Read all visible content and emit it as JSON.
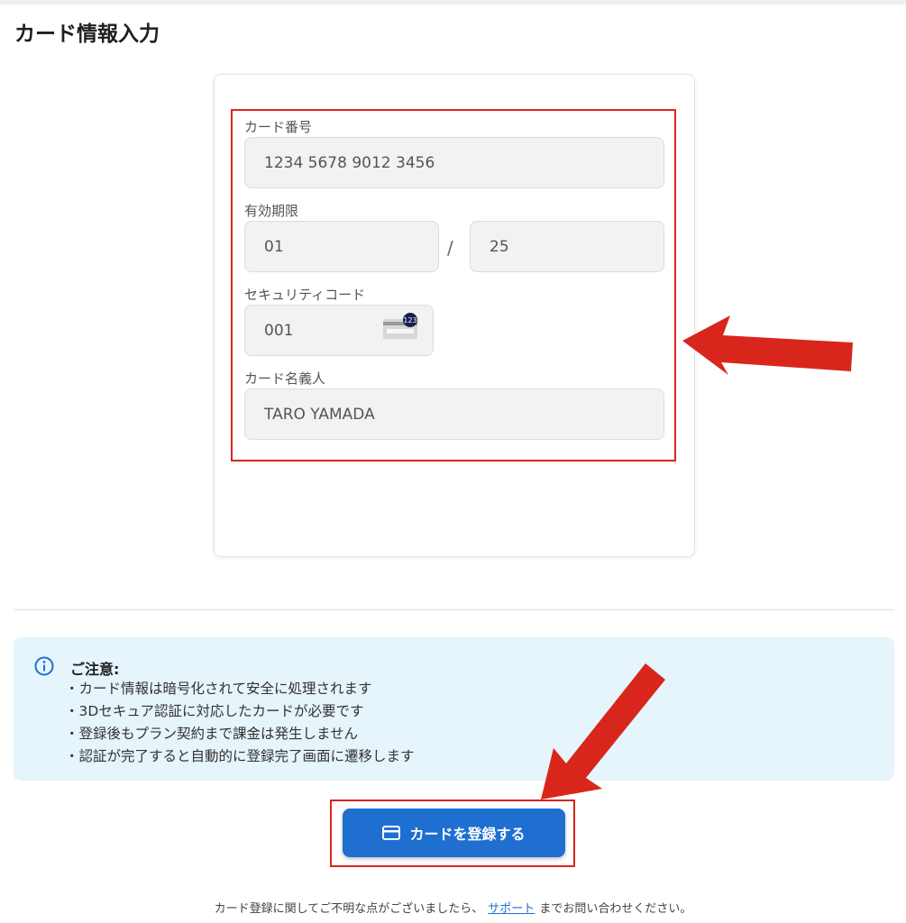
{
  "page": {
    "title": "カード情報入力"
  },
  "form": {
    "card_number": {
      "label": "カード番号",
      "value": "1234 5678 9012 3456"
    },
    "expiry": {
      "label": "有効期限",
      "month": "01",
      "separator": "/",
      "year": "25"
    },
    "security_code": {
      "label": "セキュリティコード",
      "value": "001",
      "icon": "card-cvc-icon",
      "icon_text": "123"
    },
    "card_holder": {
      "label": "カード名義人",
      "value": "TARO YAMADA"
    }
  },
  "notice": {
    "icon": "info-icon",
    "title": "ご注意:",
    "items": [
      "カード情報は暗号化されて安全に処理されます",
      "3Dセキュア認証に対応したカードが必要です",
      "登録後もプラン契約まで課金は発生しません",
      "認証が完了すると自動的に登録完了画面に遷移します"
    ]
  },
  "register_button": {
    "label": "カードを登録する",
    "icon": "credit-card-icon"
  },
  "footer": {
    "prefix": "カード登録に関してご不明な点がございましたら、",
    "link": "サポート",
    "suffix": "までお問い合わせください。"
  },
  "colors": {
    "accent": "#1f6fd1",
    "highlight": "#d9261c",
    "notice_bg": "#e6f4fb",
    "input_bg": "#f2f2f2"
  }
}
